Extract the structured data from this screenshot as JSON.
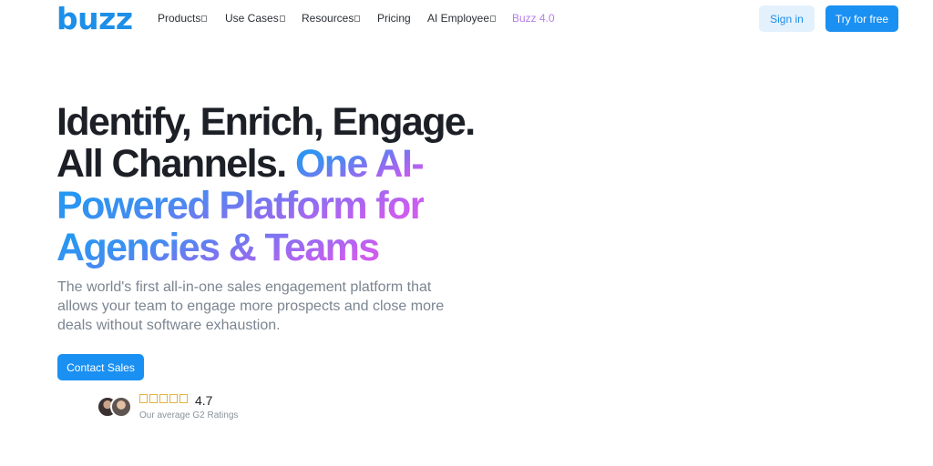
{
  "brand": {
    "logo_text": "buzz",
    "accent_color": "#1a90f3",
    "gradient_colors": [
      "#1a9bf2",
      "#8a6ff0",
      "#d95be8"
    ]
  },
  "nav": {
    "items": [
      {
        "label": "Products",
        "has_dropdown": true
      },
      {
        "label": "Use Cases",
        "has_dropdown": true
      },
      {
        "label": "Resources",
        "has_dropdown": true
      },
      {
        "label": "Pricing",
        "has_dropdown": false
      },
      {
        "label": "AI Employee",
        "has_dropdown": true
      },
      {
        "label": "Buzz 4.0",
        "has_dropdown": false,
        "color": "#b57fe6"
      }
    ]
  },
  "header_actions": {
    "sign_in": "Sign in",
    "try_free": "Try for free"
  },
  "hero": {
    "headline_line1": "Identify, Enrich, Engage.",
    "headline_line2_plain": "All Channels. ",
    "headline_highlight_1": "One AI-",
    "headline_highlight_2": "Powered Platform for",
    "headline_highlight_3": "Agencies & Teams",
    "subtext": "The world's first all-in-one sales engagement platform that allows your team to engage more prospects and close more deals without software exhaustion.",
    "cta": "Contact Sales"
  },
  "rating": {
    "value": "4.7",
    "label": "Our average G2 Ratings",
    "star_count": 5
  }
}
